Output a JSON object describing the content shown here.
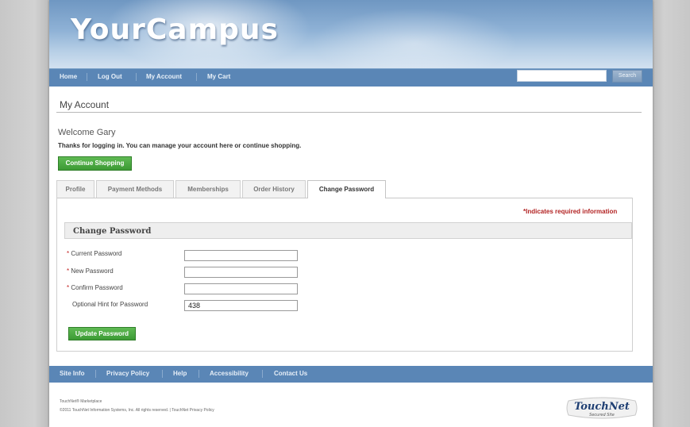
{
  "header": {
    "logo": "YourCampus"
  },
  "topnav": {
    "items": [
      "Home",
      "Log Out",
      "My Account",
      "My Cart"
    ],
    "search_value": "",
    "search_button": "Search"
  },
  "page": {
    "title": "My Account",
    "welcome": "Welcome Gary",
    "thanks": "Thanks for logging in. You can manage your account here or continue shopping.",
    "continue_button": "Continue Shopping"
  },
  "tabs": [
    {
      "label": "Profile"
    },
    {
      "label": "Payment Methods"
    },
    {
      "label": "Memberships"
    },
    {
      "label": "Order History"
    },
    {
      "label": "Change Password",
      "active": true
    }
  ],
  "form": {
    "required_note": "*Indicates required information",
    "section_title": "Change Password",
    "fields": [
      {
        "label": "Current Password",
        "required": true,
        "value": ""
      },
      {
        "label": "New Password",
        "required": true,
        "value": ""
      },
      {
        "label": "Confirm Password",
        "required": true,
        "value": ""
      },
      {
        "label": "Optional Hint for Password",
        "required": false,
        "value": "438"
      }
    ],
    "asterisk": "*",
    "update_button": "Update Password"
  },
  "footer": {
    "links": [
      "Site Info",
      "Privacy Policy",
      "Help",
      "Accessibility",
      "Contact Us"
    ],
    "product": "TouchNet® Marketplace",
    "copyright": "©2011 TouchNet Information Systems, Inc. All rights reserved. | TouchNet Privacy Policy",
    "logo_text": "TouchNet",
    "logo_sub": "Secured Site"
  },
  "colors": {
    "nav_blue": "#5a86b6",
    "button_green": "#4aa840",
    "required_red": "#b22222"
  }
}
